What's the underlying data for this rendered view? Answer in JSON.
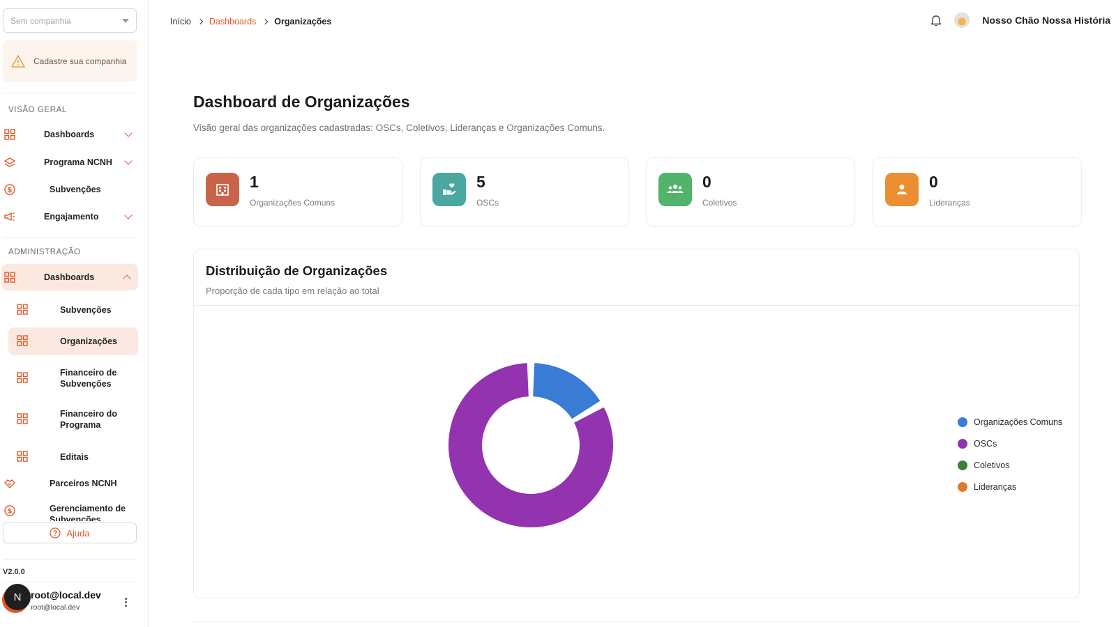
{
  "sidebar": {
    "company_select": {
      "placeholder": "Sem companhia"
    },
    "warning": {
      "text": "Cadastre sua companhia"
    },
    "sections": {
      "overview": "VISÃO GERAL",
      "admin": "ADMINISTRAÇÃO"
    },
    "overview_items": [
      {
        "label": "Dashboards",
        "icon": "grid-icon"
      },
      {
        "label": "Programa NCNH",
        "icon": "layers-icon"
      },
      {
        "label": "Subvenções",
        "icon": "dollar-circle-icon"
      },
      {
        "label": "Engajamento",
        "icon": "megaphone-icon"
      }
    ],
    "admin_items": [
      {
        "label": "Dashboards",
        "icon": "grid-icon"
      }
    ],
    "admin_sub_items": [
      {
        "label": "Subvenções",
        "icon": "grid-icon"
      },
      {
        "label": "Organizações",
        "icon": "grid-icon"
      },
      {
        "label": "Financeiro de Subvenções",
        "icon": "grid-icon"
      },
      {
        "label": "Financeiro do Programa",
        "icon": "grid-icon"
      },
      {
        "label": "Editais",
        "icon": "grid-icon"
      }
    ],
    "admin_more_items": [
      {
        "label": "Parceiros NCNH",
        "icon": "handshake-icon"
      },
      {
        "label": "Gerenciamento de Subvenções",
        "icon": "dollar-circle-icon"
      }
    ],
    "help_label": "Ajuda",
    "version": "V2.0.0",
    "user": {
      "initial": "N",
      "name": "root@local.dev",
      "email": "root@local.dev"
    }
  },
  "header": {
    "breadcrumb": [
      "Início",
      "Dashboards",
      "Organizações"
    ],
    "org_name": "Nosso Chão Nossa História"
  },
  "main": {
    "title": "Dashboard de Organizações",
    "subtitle": "Visão geral das organizações cadastradas: OSCs, Coletivos, Lideranças e Organizações Comuns.",
    "stats": [
      {
        "value": "1",
        "label": "Organizações Comuns",
        "color": "#c9644a",
        "icon": "building-icon"
      },
      {
        "value": "5",
        "label": "OSCs",
        "color": "#4aa8a0",
        "icon": "hand-heart-icon"
      },
      {
        "value": "0",
        "label": "Coletivos",
        "color": "#52b46b",
        "icon": "group-icon"
      },
      {
        "value": "0",
        "label": "Lideranças",
        "color": "#ec8f32",
        "icon": "person-icon"
      }
    ],
    "chart_card": {
      "title": "Distribuição de Organizações",
      "subtitle": "Proporção de cada tipo em relação ao total"
    }
  },
  "colors": {
    "accent": "#e0592b"
  },
  "chart_data": {
    "type": "pie",
    "categories": [
      "Organizações Comuns",
      "OSCs",
      "Coletivos",
      "Lideranças"
    ],
    "values": [
      1,
      5,
      0,
      0
    ],
    "colors": [
      "#3a7bd5",
      "#9333b0",
      "#3f7f3a",
      "#e07b2e"
    ],
    "donut": true,
    "legend": "right"
  }
}
